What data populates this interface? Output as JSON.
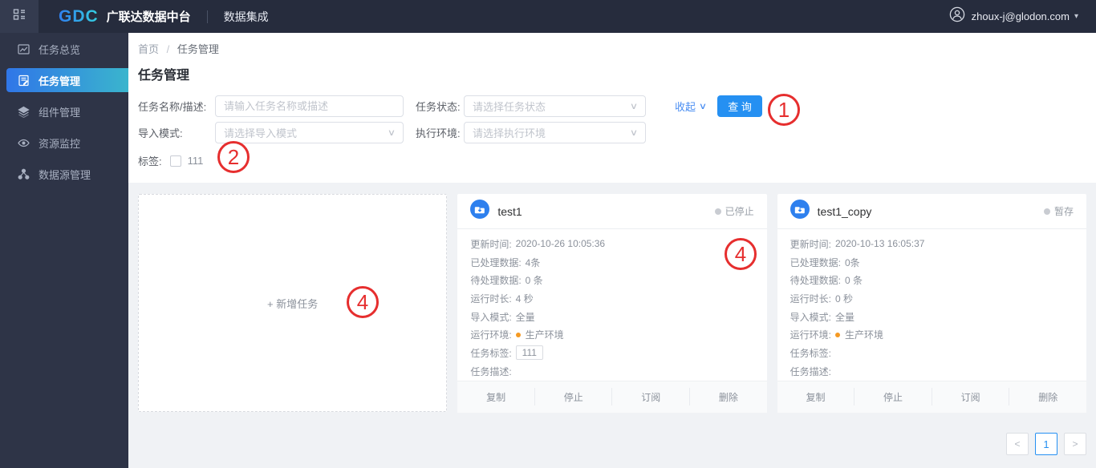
{
  "topbar": {
    "logo_text": "GDC",
    "product_name": "广联达数据中台",
    "nav_item": "数据集成",
    "user_email": "zhoux-j@glodon.com",
    "caret_icon": "▾"
  },
  "sidebar": {
    "items": [
      {
        "label": "任务总览",
        "icon": "chart-icon"
      },
      {
        "label": "任务管理",
        "icon": "document-icon"
      },
      {
        "label": "组件管理",
        "icon": "layers-icon"
      },
      {
        "label": "资源监控",
        "icon": "eye-icon"
      },
      {
        "label": "数据源管理",
        "icon": "nodes-icon"
      }
    ]
  },
  "breadcrumb": {
    "home": "首页",
    "separator": "/",
    "current": "任务管理"
  },
  "page": {
    "title": "任务管理"
  },
  "filters": {
    "name_label": "任务名称/描述:",
    "name_placeholder": "请输入任务名称或描述",
    "status_label": "任务状态:",
    "status_placeholder": "请选择任务状态",
    "mode_label": "导入模式:",
    "mode_placeholder": "请选择导入模式",
    "env_label": "执行环境:",
    "env_placeholder": "请选择执行环境",
    "collapse_label": "收起",
    "collapse_icon": "∨",
    "select_icon": "∨",
    "search_button": "查 询",
    "tag_label": "标签:",
    "tag_option": "111"
  },
  "add_card": {
    "label": "+ 新增任务"
  },
  "cards": [
    {
      "title": "test1",
      "status": "已停止",
      "rows": [
        {
          "label": "更新时间:",
          "value": "2020-10-26 10:05:36"
        },
        {
          "label": "已处理数据:",
          "value": "4条"
        },
        {
          "label": "待处理数据:",
          "value": "0 条"
        },
        {
          "label": "运行时长:",
          "value": "4 秒"
        },
        {
          "label": "导入模式:",
          "value": "全量"
        },
        {
          "label": "运行环境:",
          "value": "生产环境"
        },
        {
          "label": "任务标签:",
          "value": "111"
        },
        {
          "label": "任务描述:",
          "value": ""
        }
      ],
      "actions": [
        "复制",
        "停止",
        "订阅",
        "删除"
      ]
    },
    {
      "title": "test1_copy",
      "status": "暂存",
      "rows": [
        {
          "label": "更新时间:",
          "value": "2020-10-13 16:05:37"
        },
        {
          "label": "已处理数据:",
          "value": "0条"
        },
        {
          "label": "待处理数据:",
          "value": "0 条"
        },
        {
          "label": "运行时长:",
          "value": "0 秒"
        },
        {
          "label": "导入模式:",
          "value": "全量"
        },
        {
          "label": "运行环境:",
          "value": "生产环境"
        },
        {
          "label": "任务标签:",
          "value": ""
        },
        {
          "label": "任务描述:",
          "value": ""
        }
      ],
      "actions": [
        "复制",
        "停止",
        "订阅",
        "删除"
      ]
    }
  ],
  "annotations": [
    "1",
    "2",
    "4",
    "4"
  ],
  "pagination": {
    "prev_icon": "<",
    "page": "1",
    "next_icon": ">"
  },
  "colors": {
    "accent_blue": "#2590f2",
    "sidebar_gradient_start": "#3076e8",
    "sidebar_gradient_end": "#3ab5cd",
    "annotation_red": "#e62e2e",
    "env_dot_orange": "#f59a23",
    "status_dot_gray": "#c9ccd2"
  }
}
